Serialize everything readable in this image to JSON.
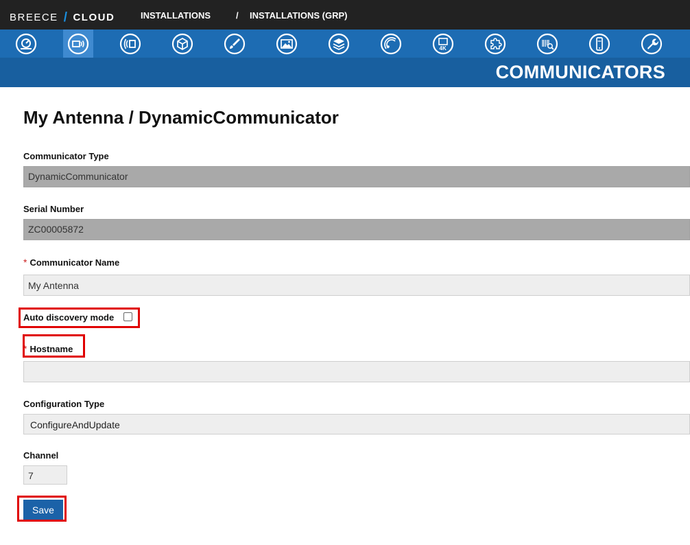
{
  "brand": {
    "name_left": "BREECE",
    "name_right": "CLOUD",
    "accent": "#1a8fe0"
  },
  "breadcrumb": {
    "items": [
      "INSTALLATIONS",
      "INSTALLATIONS (GRP)"
    ],
    "separator": "/"
  },
  "nav": {
    "icons": [
      {
        "name": "dashboard-icon"
      },
      {
        "name": "communicators-icon",
        "active": true
      },
      {
        "name": "signal-icon"
      },
      {
        "name": "box-icon"
      },
      {
        "name": "brush-icon"
      },
      {
        "name": "image-icon"
      },
      {
        "name": "layers-icon"
      },
      {
        "name": "radar-icon"
      },
      {
        "name": "display-4k-icon"
      },
      {
        "name": "puzzle-icon"
      },
      {
        "name": "barcode-search-icon"
      },
      {
        "name": "mobile-device-icon"
      },
      {
        "name": "wrench-icon"
      }
    ]
  },
  "section": {
    "title": "COMMUNICATORS"
  },
  "form": {
    "title": "My Antenna / DynamicCommunicator",
    "communicator_type": {
      "label": "Communicator Type",
      "value": "DynamicCommunicator"
    },
    "serial_number": {
      "label": "Serial Number",
      "value": "ZC00005872"
    },
    "communicator_name": {
      "label": "Communicator Name",
      "value": "My Antenna",
      "required": "*"
    },
    "auto_discovery": {
      "label": "Auto discovery mode",
      "checked": false
    },
    "hostname": {
      "label": "Hostname",
      "value": "",
      "required": "*"
    },
    "configuration_type": {
      "label": "Configuration Type",
      "value": "ConfigureAndUpdate"
    },
    "channel": {
      "label": "Channel",
      "value": "7"
    },
    "save_label": "Save"
  },
  "colors": {
    "topbar": "#222222",
    "iconbar": "#1d6cb3",
    "sectionbar": "#185f9f",
    "highlight": "#e00000"
  }
}
